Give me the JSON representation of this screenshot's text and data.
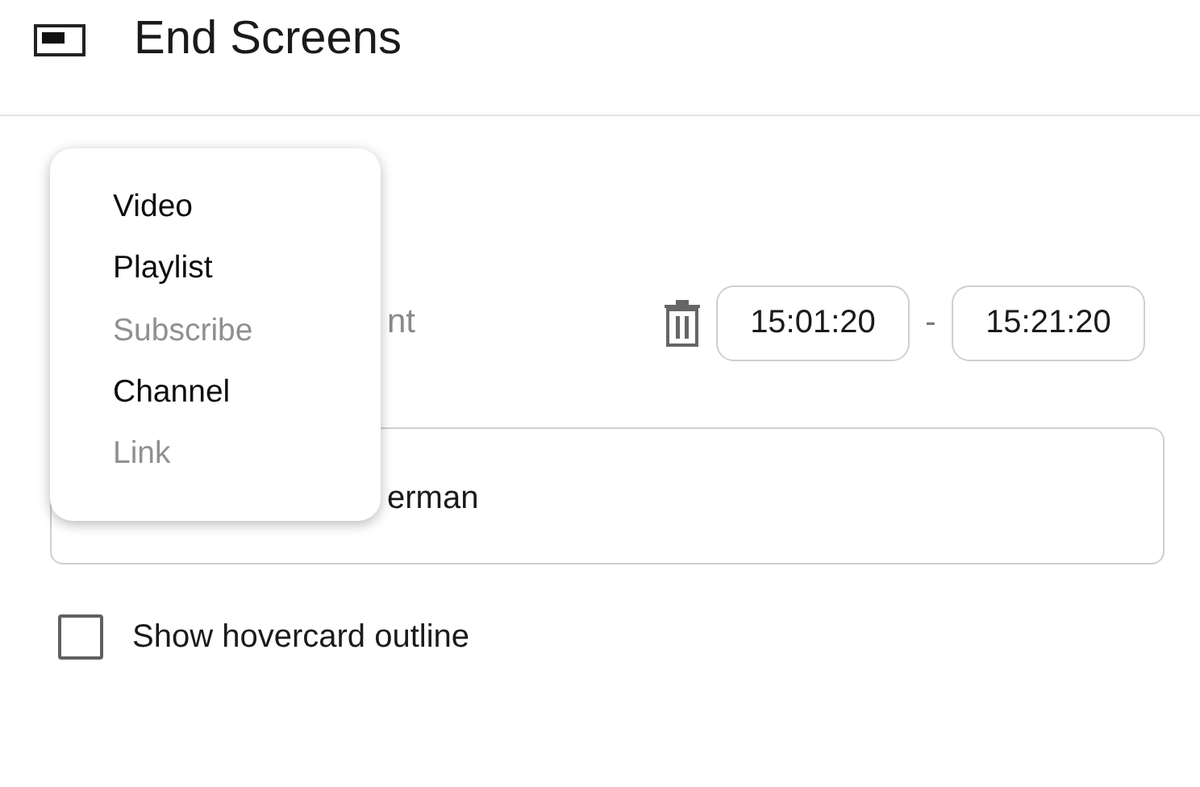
{
  "header": {
    "title": "End Screens"
  },
  "element_row": {
    "label": "nt",
    "start_time": "15:01:20",
    "separator": "-",
    "end_time": "15:21:20"
  },
  "element_field": {
    "value": "erman"
  },
  "hovercard_outline": {
    "label": "Show hovercard outline",
    "checked": false
  },
  "menu": {
    "items": [
      {
        "label": "Video",
        "disabled": false
      },
      {
        "label": "Playlist",
        "disabled": false
      },
      {
        "label": "Subscribe",
        "disabled": true
      },
      {
        "label": "Channel",
        "disabled": false
      },
      {
        "label": "Link",
        "disabled": true
      }
    ]
  }
}
